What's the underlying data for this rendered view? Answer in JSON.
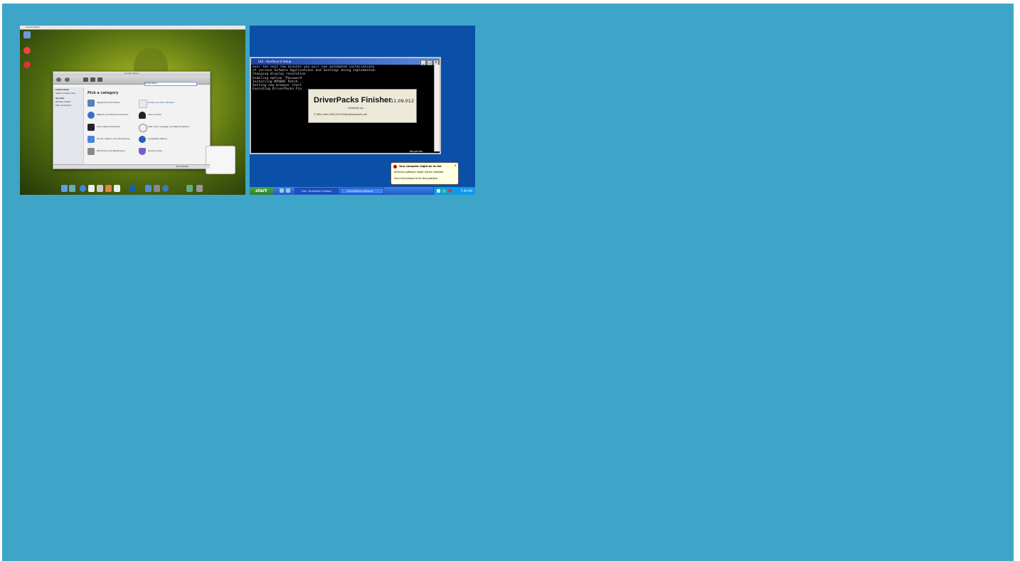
{
  "mac": {
    "menubar_left": "Control Panel",
    "window_title": "Control Panel",
    "address": "Control Panel",
    "sidebar": [
      "Control Panel",
      "Switch to Classic View",
      "See Also",
      "Windows Update",
      "Help and Support"
    ],
    "heading": "Pick a category",
    "categories": [
      "Appearance and Themes",
      "Printers and Other Hardware",
      "Network and Internet Connections",
      "User Accounts",
      "Add or Remove Programs",
      "Date, Time, Language, and Regional Options",
      "Sounds, Speech, and Audio Devices",
      "Accessibility Options",
      "Performance and Maintenance",
      "Security Center"
    ],
    "status": "My Computer"
  },
  "xp": {
    "console_title": "GUI - RunOnce.U Setup",
    "console_lines": [
      "Over the next few minutes you will see automated installations",
      "of various Sofware Applications and Settings being implemented.",
      "",
      "Changing display resolution",
      "Enabling option \"Password",
      "Installing MP4BOF Patch...",
      "Setting new browser start",
      "Executing DriverPacks Fin"
    ],
    "finisher_title": "DriverPacks Finisher",
    "finisher_version": "11.09.012",
    "finisher_status": "Cleaning up...",
    "finisher_copyright": "© Wim Leers 2004-2014 http://driverpacks.net",
    "recycle_bin": "Recycle Bin",
    "balloon_title": "Your computer might be at risk",
    "balloon_line1": "Antivirus software might not be installed",
    "balloon_line2": "Click this balloon to fix this problem.",
    "start": "start",
    "task1": "GUI - RunOnce.U Setup",
    "task2": "DriverPacks Finisher",
    "clock": "7:40 AM"
  }
}
